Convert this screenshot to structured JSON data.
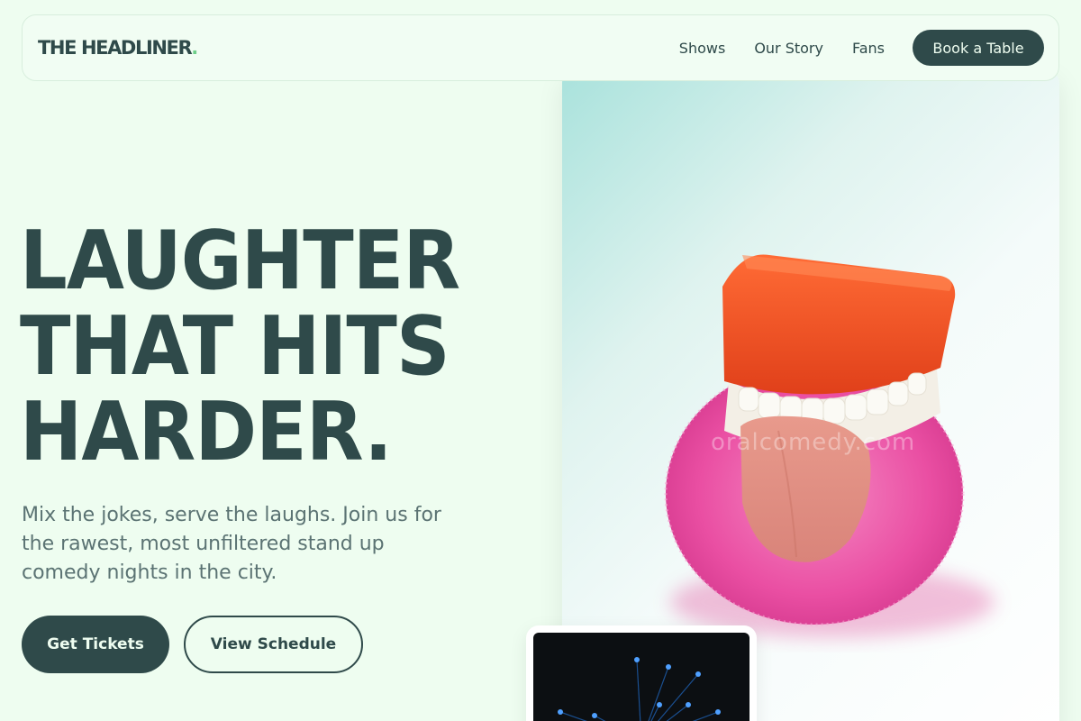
{
  "brand": {
    "name": "THE HEADLINER",
    "dot": "."
  },
  "nav": {
    "links": [
      "Shows",
      "Our Story",
      "Fans"
    ],
    "cta": "Book a Table"
  },
  "hero": {
    "title_lines": [
      "LAUGHTER",
      "THAT HITS",
      "HARDER."
    ],
    "subtitle": "Mix the jokes, serve the laughs. Join us for the rawest, most unfiltered stand up comedy nights in the city.",
    "primary_button": "Get Tickets",
    "secondary_button": "View Schedule",
    "image_watermark": "oralcomedy.com"
  },
  "colors": {
    "background": "#eefdf0",
    "primary": "#2f4a4a",
    "accent": "#6fcf8a",
    "muted_text": "#5b7373"
  }
}
